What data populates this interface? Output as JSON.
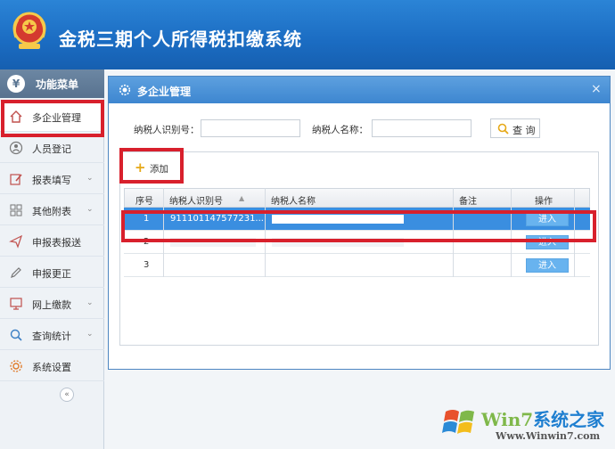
{
  "app": {
    "title": "金税三期个人所得税扣缴系统"
  },
  "sidebar": {
    "header": "功能菜单",
    "header_icon": "yen-icon",
    "collapse_glyph": "«",
    "items": [
      {
        "label": "多企业管理",
        "icon": "house-icon",
        "active": true
      },
      {
        "label": "人员登记",
        "icon": "person-icon"
      },
      {
        "label": "报表填写",
        "icon": "edit-icon",
        "caret": "⌄"
      },
      {
        "label": "其他附表",
        "icon": "grid-icon",
        "caret": "⌄"
      },
      {
        "label": "申报表报送",
        "icon": "send-icon"
      },
      {
        "label": "申报更正",
        "icon": "pencil-icon"
      },
      {
        "label": "网上缴款",
        "icon": "monitor-icon",
        "caret": "⌄"
      },
      {
        "label": "查询统计",
        "icon": "search-icon",
        "caret": "⌄"
      },
      {
        "label": "系统设置",
        "icon": "gear-icon"
      }
    ]
  },
  "dialog": {
    "title": "多企业管理",
    "close_glyph": "×",
    "search": {
      "taxpayer_id_label": "纳税人识别号：",
      "taxpayer_id_value": "",
      "taxpayer_name_label": "纳税人名称：",
      "taxpayer_name_value": "",
      "query_label": "查 询"
    },
    "add_label": "添加",
    "table": {
      "headers": [
        "序号",
        "纳税人识别号",
        "纳税人名称",
        "备注",
        "操作"
      ],
      "rows": [
        {
          "no": "1",
          "taxpayer_id": "911101147577231...",
          "action": "进入",
          "selected": true
        },
        {
          "no": "2",
          "taxpayer_id": "",
          "action": "进入"
        },
        {
          "no": "3",
          "taxpayer_id": "",
          "action": "进入"
        }
      ]
    }
  },
  "watermark": {
    "brand_win": "Win7",
    "brand_rest": "系统之家",
    "url": "Www.Winwin7.com"
  },
  "colors": {
    "header_blue": "#1b6cc2",
    "selected_row": "#3a8ee0",
    "highlight_red": "#d8202c",
    "enter_button": "#68b3ef"
  }
}
